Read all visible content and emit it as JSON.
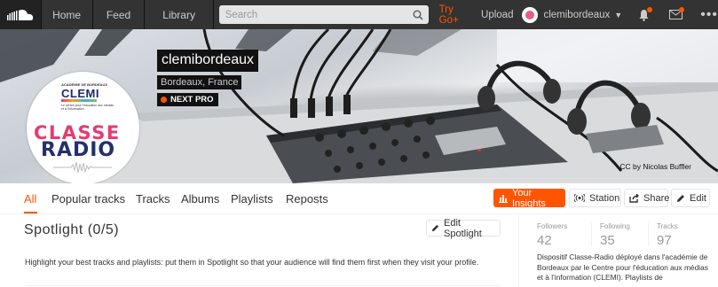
{
  "nav": {
    "home": "Home",
    "feed": "Feed",
    "library": "Library",
    "search_placeholder": "Search",
    "try_go": "Try Go+",
    "upload": "Upload",
    "username": "clemibordeaux",
    "more": "•••"
  },
  "profile": {
    "avatar": {
      "academie": "ACADÉMIE DE BORDEAUX",
      "clemi": "CLEMI",
      "subline": "Le centre pour l'éducation aux médias et à l'information",
      "classe": "CLASSE",
      "radio": "RADIO"
    },
    "name": "clemibordeaux",
    "location": "Bordeaux, France",
    "badge": "NEXT PRO",
    "header_credit": "CC by Nicolas Buffler"
  },
  "tabs": {
    "all": "All",
    "popular": "Popular tracks",
    "tracks": "Tracks",
    "albums": "Albums",
    "playlists": "Playlists",
    "reposts": "Reposts"
  },
  "actions": {
    "insights": "Your Insights",
    "station": "Station",
    "share": "Share",
    "edit": "Edit"
  },
  "spotlight": {
    "title": "Spotlight (0/5)",
    "edit": "Edit Spotlight",
    "description": "Highlight your best tracks and playlists: put them in Spotlight so that your audience will find them first when they visit your profile."
  },
  "stats": {
    "followers_label": "Followers",
    "followers": "42",
    "following_label": "Following",
    "following": "35",
    "tracks_label": "Tracks",
    "tracks": "97"
  },
  "bio": "Dispositif Classe-Radio déployé dans l'académie de Bordeaux par le Centre pour l'éducation aux médias et à l'information (CLEMI). Playlists de",
  "colors": {
    "accent": "#ff5500",
    "topbar": "#333333"
  }
}
